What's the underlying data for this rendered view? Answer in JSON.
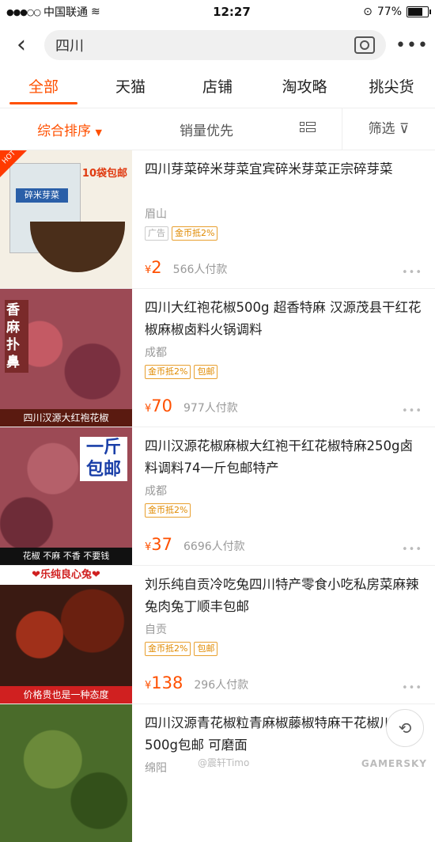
{
  "status": {
    "carrier": "中国联通",
    "time": "12:27",
    "battery": "77%",
    "battery_level": 0.77
  },
  "search": {
    "query": "四川"
  },
  "tabs": [
    "全部",
    "天猫",
    "店铺",
    "淘攻略",
    "挑尖货"
  ],
  "sort": {
    "primary": "综合排序",
    "sales": "销量优先",
    "filter": "筛选"
  },
  "items": [
    {
      "title": "四川芽菜碎米芽菜宜宾碎米芽菜正宗碎芽菜",
      "location": "眉山",
      "tags": [
        "广告",
        "金币抵2%"
      ],
      "price": "2",
      "sold": "566人付款",
      "thumb": {
        "badge": "HOT",
        "text1": "10袋包邮",
        "text2": "碎米芽菜"
      }
    },
    {
      "title": "四川大红袍花椒500g 超香特麻 汉源茂县干红花椒麻椒卤料火锅调料",
      "location": "成都",
      "tags": [
        "金币抵2%",
        "包邮"
      ],
      "price": "70",
      "sold": "977人付款",
      "thumb": {
        "text1": "香麻扑鼻",
        "text2": "四川汉源大红袍花椒"
      }
    },
    {
      "title": "四川汉源花椒麻椒大红袍干红花椒特麻250g卤料调料74一斤包邮特产",
      "location": "成都",
      "tags": [
        "金币抵2%"
      ],
      "price": "37",
      "sold": "6696人付款",
      "thumb": {
        "text1": "一斤包邮",
        "text2": "花椒 不麻 不香 不要钱"
      }
    },
    {
      "title": "刘乐纯自贡冷吃兔四川特产零食小吃私房菜麻辣兔肉兔丁顺丰包邮",
      "location": "自贡",
      "tags": [
        "金币抵2%",
        "包邮"
      ],
      "price": "138",
      "sold": "296人付款",
      "thumb": {
        "text1": "❤乐纯良心兔❤",
        "text2": "价格贵也是一种态度"
      }
    },
    {
      "title": "四川汉源青花椒粒青麻椒藤椒特麻干花椒川椒500g包邮 可磨面",
      "location": "绵阳",
      "tags": [],
      "price": "",
      "sold": "",
      "thumb": {
        "text1": "",
        "text2": ""
      }
    }
  ],
  "watermark": "GAMERSKY",
  "watermark2": "@震轩Timo",
  "colors": {
    "accent": "#ff5000"
  }
}
